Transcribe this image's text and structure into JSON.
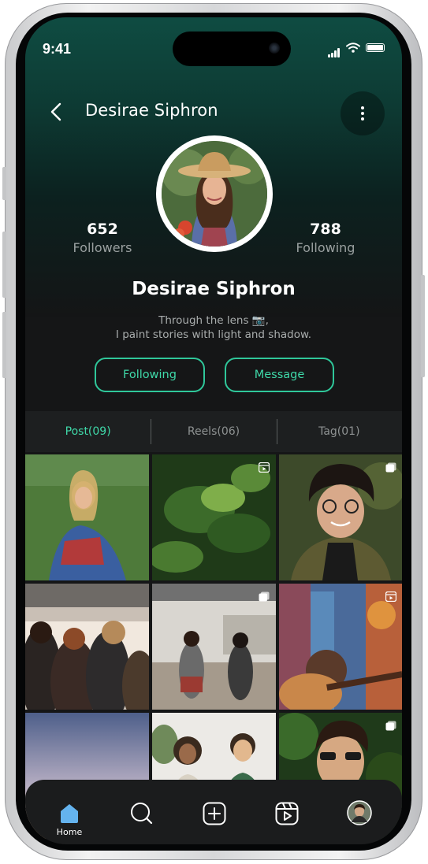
{
  "status_bar": {
    "time": "9:41"
  },
  "header": {
    "title": "Desirae Siphron"
  },
  "profile": {
    "name": "Desirae Siphron",
    "bio_line1": "Through the lens 📷,",
    "bio_line2": "I paint stories with light and shadow.",
    "followers": {
      "count": "652",
      "label": "Followers"
    },
    "following": {
      "count": "788",
      "label": "Following"
    }
  },
  "actions": {
    "following_label": "Following",
    "message_label": "Message"
  },
  "tabs": [
    {
      "label": "Post(09)",
      "active": true
    },
    {
      "label": "Reels(06)",
      "active": false
    },
    {
      "label": "Tag(01)",
      "active": false
    }
  ],
  "grid_items": [
    {
      "kind": "photo",
      "badge": "none"
    },
    {
      "kind": "reel",
      "badge": "reel-icon"
    },
    {
      "kind": "carousel",
      "badge": "multiple-icon"
    },
    {
      "kind": "photo",
      "badge": "none"
    },
    {
      "kind": "carousel",
      "badge": "multiple-icon"
    },
    {
      "kind": "reel",
      "badge": "reel-icon"
    },
    {
      "kind": "photo",
      "badge": "none"
    },
    {
      "kind": "photo",
      "badge": "none"
    },
    {
      "kind": "carousel",
      "badge": "multiple-icon"
    }
  ],
  "bottom_nav": [
    {
      "icon": "home-icon",
      "label": "Home",
      "active": true
    },
    {
      "icon": "search-icon",
      "label": ""
    },
    {
      "icon": "add-icon",
      "label": ""
    },
    {
      "icon": "reels-icon",
      "label": ""
    },
    {
      "icon": "profile-avatar",
      "label": ""
    }
  ],
  "colors": {
    "accent": "#2fc79a",
    "header_gradient_top": "#0f4c42",
    "background": "#151617"
  }
}
